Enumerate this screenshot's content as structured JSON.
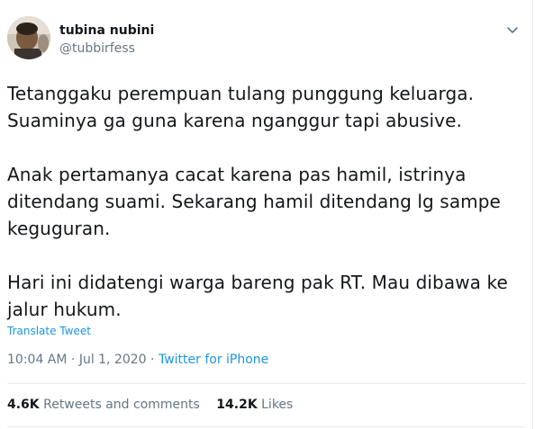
{
  "user": {
    "name": "tubina nubini",
    "handle": "@tubbirfess"
  },
  "tweet": {
    "paragraphs": [
      "Tetanggaku perempuan tulang punggung keluarga. Suaminya ga guna karena nganggur tapi abusive.",
      "Anak pertamanya cacat karena pas hamil, istrinya ditendang suami. Sekarang hamil ditendang lg sampe keguguran.",
      "Hari ini didatengi warga bareng pak RT. Mau dibawa ke jalur hukum."
    ],
    "translate_label": "Translate Tweet",
    "time": "10:04 AM",
    "date": "Jul 1, 2020",
    "separator": "·",
    "source": "Twitter for iPhone"
  },
  "stats": {
    "retweets_count": "4.6K",
    "retweets_label": "Retweets and comments",
    "likes_count": "14.2K",
    "likes_label": "Likes"
  },
  "icons": {
    "avatar": "avatar-photo",
    "caret": "chevron-down-icon"
  },
  "colors": {
    "link": "#1b95e0",
    "secondary": "#657786",
    "text": "#14171a",
    "divider": "#e6ecf0"
  }
}
